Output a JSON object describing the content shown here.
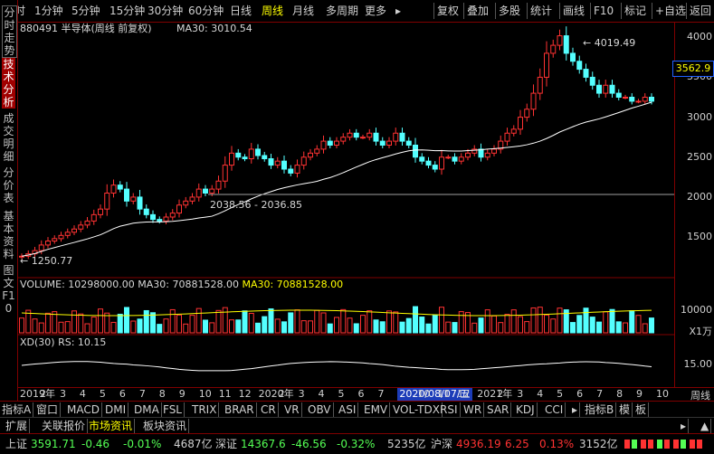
{
  "toolbar": {
    "periods": [
      "分时",
      "1分钟",
      "5分钟",
      "15分钟",
      "30分钟",
      "60分钟",
      "日线",
      "周线",
      "月线",
      "多周期",
      "更多"
    ],
    "active_period": "周线",
    "more_caret": "▸",
    "actions": [
      "复权",
      "叠加",
      "多股",
      "统计",
      "画线",
      "F10",
      "标记",
      "+自选",
      "返回"
    ]
  },
  "left_tabs": [
    "分时走势",
    "技术分析",
    "成交明细",
    "分价表",
    "基本资料",
    "图文F10"
  ],
  "left_active": "技术分析",
  "chart": {
    "header": "880491 半导体(周线 前复权)",
    "ma_label": "MA30: 3010.54",
    "current_price": "3562.9",
    "y_ticks": [
      "4000",
      "3500",
      "3000",
      "2500",
      "2000",
      "1500"
    ],
    "high_label": "4019.49",
    "low_label": "1250.77",
    "range_label": "2038.56 - 2036.85",
    "volume_header": "VOLUME: 10298000.00",
    "volume_ma": "MA30: 70881528.00",
    "volume_ma2": "MA30: 70881528.00",
    "volume_tick": "10000",
    "volume_unit": "X1万",
    "xd_header": "XD(30)",
    "xd_rs": "RS: 10.15",
    "xd_tick": "15.00",
    "date_labels": [
      "2019年",
      "2",
      "3",
      "4",
      "5",
      "6",
      "7",
      "8",
      "9",
      "10",
      "11",
      "12",
      "2020年",
      "2",
      "3",
      "4",
      "5",
      "6",
      "7",
      "2020/08/07/五",
      "10",
      "11",
      "12",
      "2021年",
      "2",
      "3",
      "4",
      "5",
      "6",
      "7",
      "8",
      "9",
      "10"
    ],
    "period_name": "周线"
  },
  "chart_data": {
    "type": "candlestick",
    "title": "880491 半导体(周线 前复权)",
    "ma30": 3010.54,
    "high": 4019.49,
    "low": 1250.77,
    "current": 3562.9,
    "ylim": [
      1150,
      4150
    ],
    "closes": [
      1260,
      1290,
      1330,
      1400,
      1450,
      1480,
      1520,
      1560,
      1600,
      1650,
      1700,
      1780,
      1850,
      2050,
      2150,
      2100,
      1950,
      2000,
      1850,
      1780,
      1720,
      1700,
      1750,
      1800,
      1900,
      1950,
      2000,
      2100,
      2050,
      2100,
      2200,
      2400,
      2550,
      2500,
      2480,
      2600,
      2520,
      2480,
      2400,
      2450,
      2350,
      2300,
      2400,
      2500,
      2550,
      2600,
      2700,
      2650,
      2700,
      2750,
      2800,
      2750,
      2750,
      2800,
      2700,
      2650,
      2700,
      2800,
      2700,
      2650,
      2500,
      2450,
      2400,
      2350,
      2500,
      2500,
      2450,
      2500,
      2550,
      2600,
      2500,
      2550,
      2600,
      2700,
      2800,
      2850,
      3000,
      3100,
      3300,
      3500,
      3800,
      3900,
      4019,
      3800,
      3700,
      3600,
      3500,
      3400,
      3300,
      3400,
      3300,
      3250,
      3250,
      3200,
      3200,
      3250,
      3200
    ],
    "opens": [
      1250,
      1260,
      1290,
      1330,
      1400,
      1450,
      1480,
      1520,
      1560,
      1600,
      1650,
      1700,
      1780,
      1850,
      2050,
      2150,
      2100,
      1950,
      2000,
      1850,
      1780,
      1720,
      1700,
      1750,
      1800,
      1900,
      1950,
      2000,
      2100,
      2050,
      2100,
      2200,
      2400,
      2550,
      2500,
      2480,
      2600,
      2520,
      2480,
      2400,
      2450,
      2350,
      2300,
      2400,
      2500,
      2550,
      2600,
      2700,
      2650,
      2700,
      2750,
      2800,
      2750,
      2750,
      2800,
      2700,
      2650,
      2700,
      2800,
      2700,
      2650,
      2500,
      2450,
      2400,
      2350,
      2500,
      2500,
      2450,
      2500,
      2550,
      2600,
      2500,
      2550,
      2600,
      2700,
      2800,
      2850,
      3000,
      3100,
      3300,
      3500,
      3800,
      3900,
      4019,
      3800,
      3700,
      3600,
      3500,
      3400,
      3300,
      3400,
      3300,
      3250,
      3250,
      3200,
      3200,
      3250
    ]
  },
  "bottom_tabs": [
    "指标A",
    "窗口",
    "MACD",
    "DMI",
    "DMA",
    "FSL",
    "TRIX",
    "BRAR",
    "CR",
    "VR",
    "OBV",
    "ASI",
    "EMV",
    "VOL-TDX",
    "RSI",
    "WR",
    "SAR",
    "KDJ",
    "CCI",
    "▸",
    "指标B",
    "模",
    "板"
  ],
  "sub_tabs": [
    "扩展",
    "关联报价",
    "市场资讯",
    "板块资讯"
  ],
  "sub_tab_symbols": [
    "▸",
    "▲"
  ],
  "status": {
    "sh_label": "上证",
    "sh_price": "3591.71",
    "sh_change": "-0.46",
    "sh_pct": "-0.01%",
    "sh_amount": "4687亿",
    "sz_label": "深证",
    "sz_price": "14367.6",
    "sz_change": "-46.56",
    "sz_pct": "-0.32%",
    "sz_amount": "5235亿",
    "hs_label": "沪深",
    "hs_price": "4936.19",
    "hs_change": "6.25",
    "hs_pct": "0.13%",
    "hs_amount": "3152亿"
  },
  "colors": {
    "up": "#ff3232",
    "down": "#54ffff",
    "ma": "#ffffff",
    "accent": "#ffff00",
    "border": "#800000"
  }
}
